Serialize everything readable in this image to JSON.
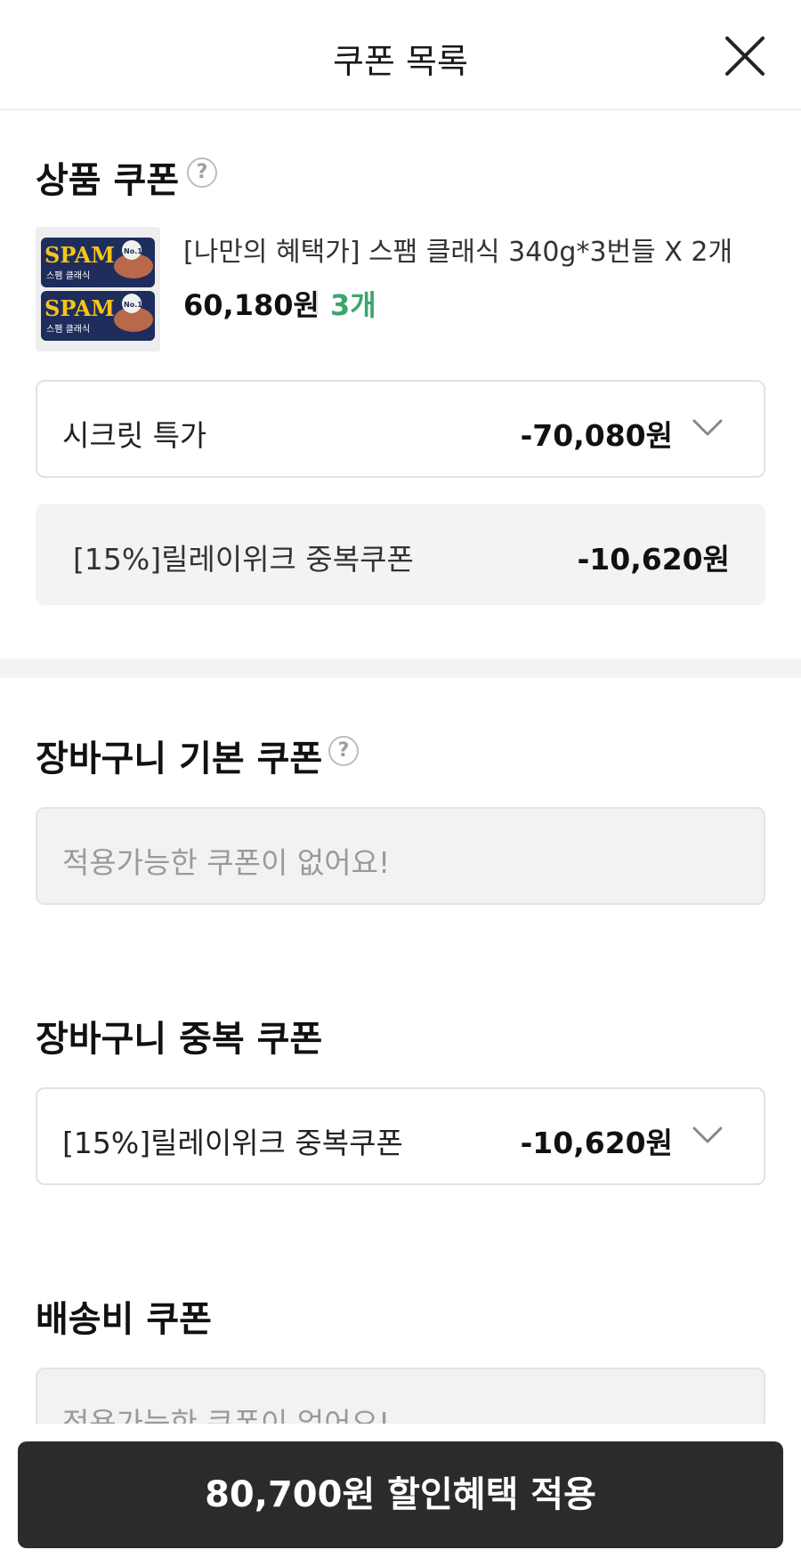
{
  "header": {
    "title": "쿠폰 목록"
  },
  "product_coupon": {
    "title": "상품 쿠폰",
    "product": {
      "thumbnail_brand": "SPAM",
      "thumbnail_subtitle": "스팸 클래식",
      "thumbnail_badge": "No.1",
      "name": "[나만의 혜택가] 스팸 클래식 340g*3번들 X 2개",
      "price": "60,180원",
      "quantity": "3개"
    },
    "selected": {
      "label": "시크릿 특가",
      "value": "-70,080원"
    },
    "applied": {
      "label": "[15%]릴레이위크 중복쿠폰",
      "value": "-10,620원"
    }
  },
  "cart_basic_coupon": {
    "title": "장바구니 기본 쿠폰",
    "empty_text": "적용가능한 쿠폰이 없어요!"
  },
  "cart_stack_coupon": {
    "title": "장바구니 중복 쿠폰",
    "selected": {
      "label": "[15%]릴레이위크 중복쿠폰",
      "value": "-10,620원"
    }
  },
  "shipping_coupon": {
    "title": "배송비 쿠폰",
    "empty_text": "적용가능한 쿠폰이 없어요!"
  },
  "help_symbol": "?",
  "apply_button": {
    "label": "80,700원 할인혜택 적용"
  },
  "colors": {
    "accent_green": "#3aa56d",
    "button_dark": "#2b2b2b"
  }
}
